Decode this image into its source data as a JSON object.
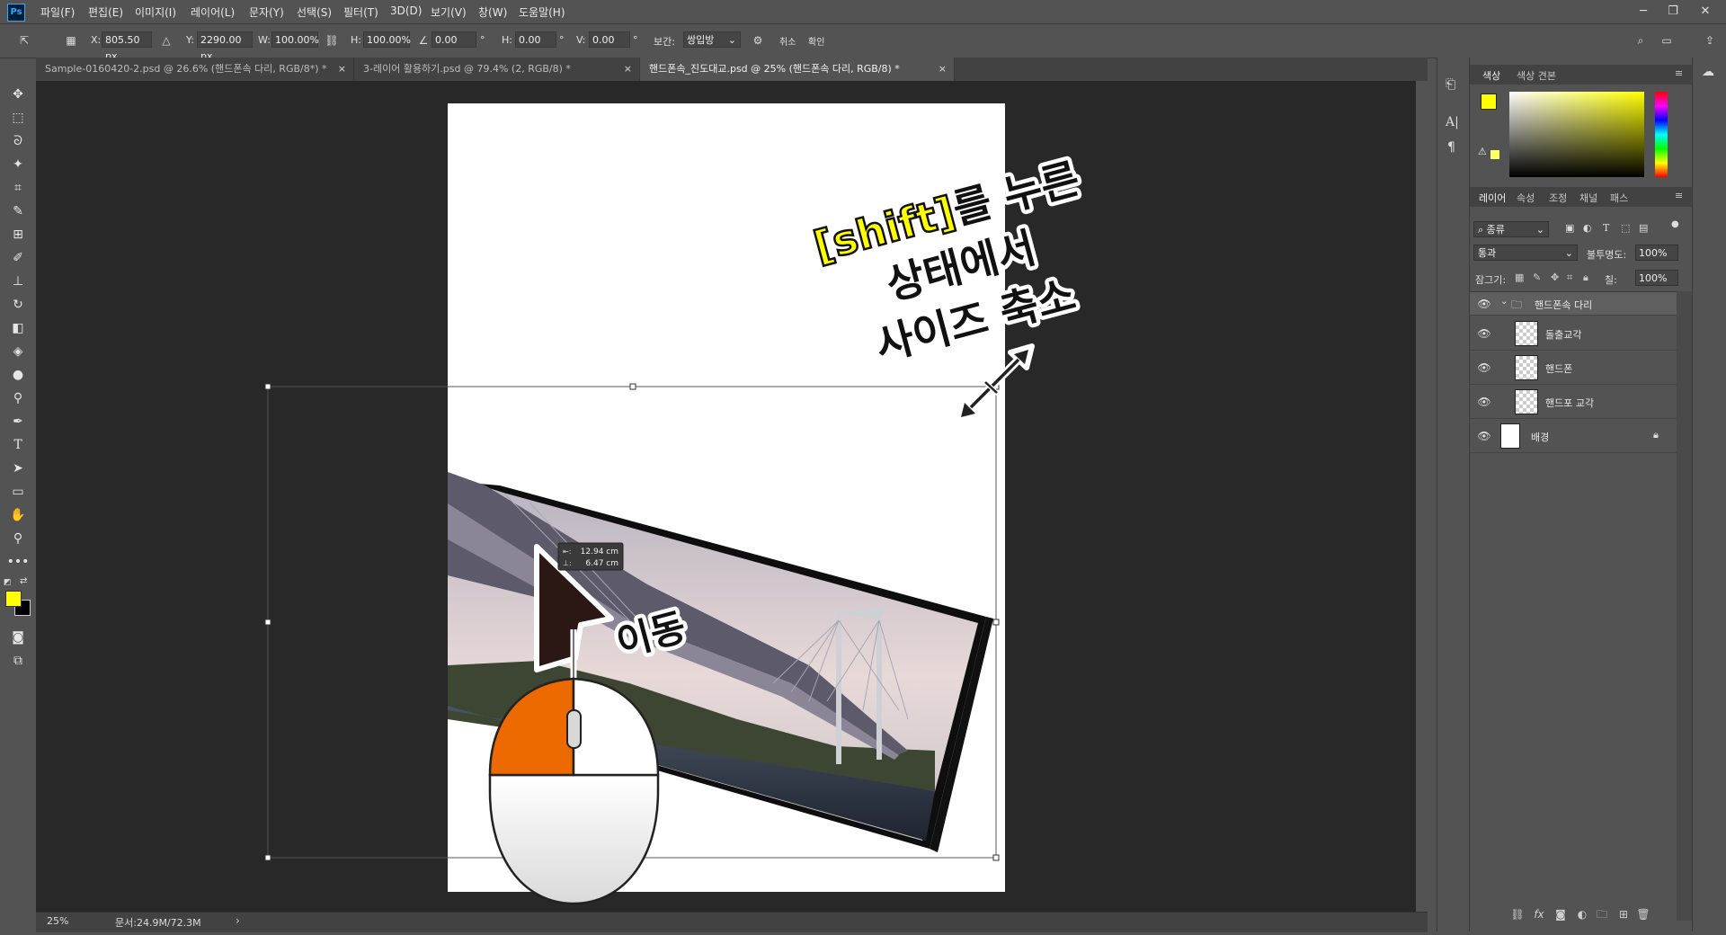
{
  "app": {
    "logo": "Ps"
  },
  "menu": [
    "파일(F)",
    "편집(E)",
    "이미지(I)",
    "레이어(L)",
    "문자(Y)",
    "선택(S)",
    "필터(T)",
    "3D(D)",
    "보기(V)",
    "창(W)",
    "도움말(H)"
  ],
  "window_controls": {
    "minimize": "─",
    "restore": "❐",
    "close": "✕"
  },
  "options": {
    "x_label": "X:",
    "x_value": "805.50 px",
    "y_label": "Y:",
    "y_value": "2290.00 px",
    "w_label": "W:",
    "w_value": "100.00%",
    "h_label": "H:",
    "h_value": "100.00%",
    "angle_value": "0.00",
    "angle_unit": "°",
    "hskew_label": "H:",
    "hskew_value": "0.00",
    "hskew_unit": "°",
    "vskew_label": "V:",
    "vskew_value": "0.00",
    "vskew_unit": "°",
    "interp_label": "보간:",
    "interp_value": "쌍입방",
    "cancel_label": "취소",
    "commit_label": "확인"
  },
  "tabs": [
    {
      "label": "Sample-0160420-2.psd @ 26.6% (핸드폰속 다리, RGB/8*) *",
      "active": false
    },
    {
      "label": "3-레이어 활용하기.psd @ 79.4% (2, RGB/8) *",
      "active": false
    },
    {
      "label": "핸드폰속_진도대교.psd @ 25% (핸드폰속 다리, RGB/8) *",
      "active": true
    }
  ],
  "tab_close": "×",
  "canvas": {
    "measure_w": "12.94 cm",
    "measure_h": "6.47 cm",
    "annotation_shift": "[shift]",
    "annotation_line1_rest": "를 누른",
    "annotation_line2": "상태에서",
    "annotation_line3": "사이즈 축소",
    "annotation_move": "이동"
  },
  "status": {
    "zoom": "25%",
    "doc": "문서:24.9M/72.3M"
  },
  "color_panel": {
    "tab_color": "색상",
    "tab_swatches": "색상 견본",
    "fg_color": "#ffff00",
    "bg_color": "#000000"
  },
  "layers_panel": {
    "tabs": [
      "레이어",
      "속성",
      "조정",
      "채널",
      "패스"
    ],
    "filter_label": "종류",
    "blend_mode": "통과",
    "opacity_label": "불투명도:",
    "opacity_value": "100%",
    "lock_label": "잠그기:",
    "fill_label": "칠:",
    "fill_value": "100%",
    "group_name": "핸드폰속 다리",
    "layers": [
      {
        "name": "돌출교각"
      },
      {
        "name": "핸드폰"
      },
      {
        "name": "핸드포 교각"
      }
    ],
    "background_name": "배경"
  }
}
